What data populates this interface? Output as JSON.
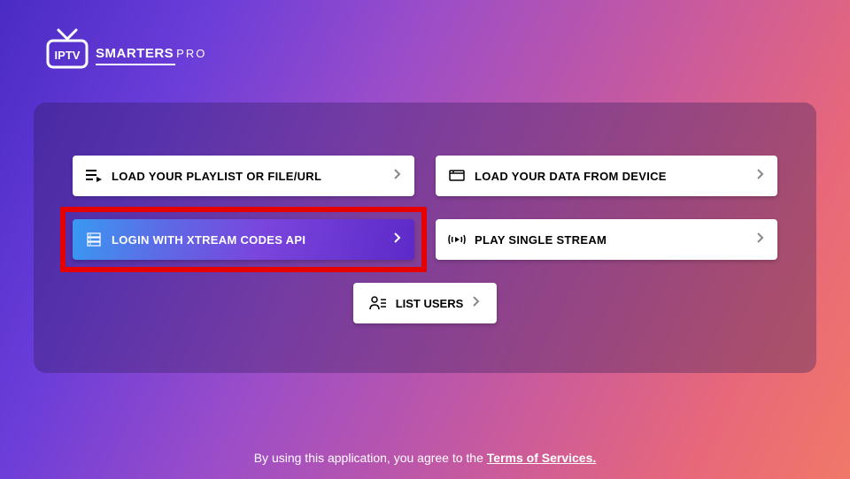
{
  "logo": {
    "iptv": "IPTV",
    "brand": "SMARTERS",
    "pro": "PRO"
  },
  "options": {
    "playlist": "LOAD YOUR PLAYLIST OR FILE/URL",
    "device": "LOAD YOUR DATA FROM DEVICE",
    "xtream": "LOGIN WITH XTREAM CODES API",
    "stream": "PLAY SINGLE STREAM",
    "listusers": "LIST USERS"
  },
  "footer": {
    "prefix": "By using this application, you agree to the ",
    "tos": "Terms of Services."
  }
}
